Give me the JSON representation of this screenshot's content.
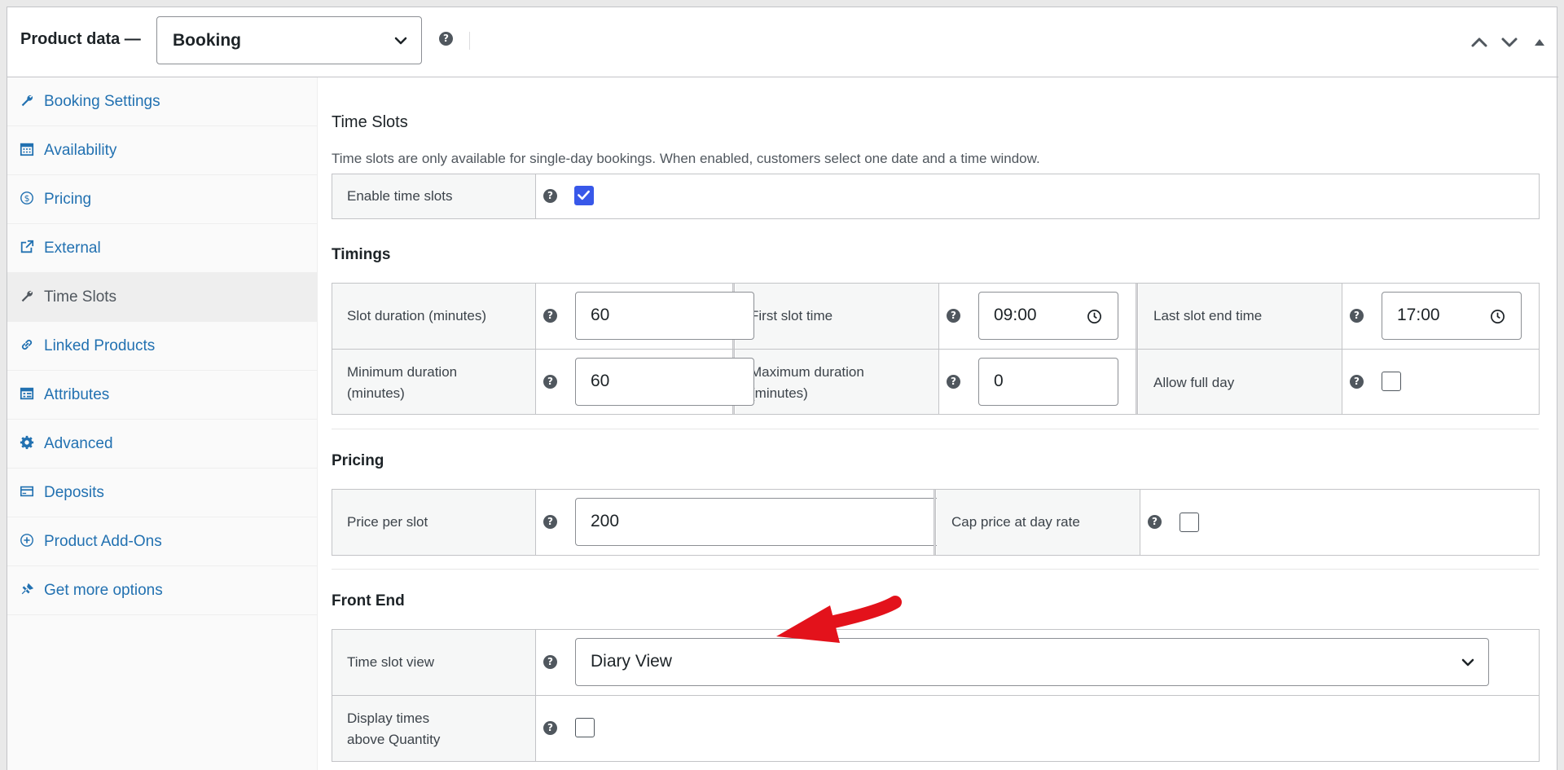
{
  "header": {
    "title": "Product data —",
    "type_select": "Booking"
  },
  "sidebar": {
    "items": [
      {
        "label": "Booking Settings",
        "icon": "wrench-icon"
      },
      {
        "label": "Availability",
        "icon": "calendar-icon"
      },
      {
        "label": "Pricing",
        "icon": "dollar-icon"
      },
      {
        "label": "External",
        "icon": "external-link-icon"
      },
      {
        "label": "Time Slots",
        "icon": "wrench-icon",
        "active": true
      },
      {
        "label": "Linked Products",
        "icon": "link-icon"
      },
      {
        "label": "Attributes",
        "icon": "list-icon"
      },
      {
        "label": "Advanced",
        "icon": "gear-icon"
      },
      {
        "label": "Deposits",
        "icon": "card-icon"
      },
      {
        "label": "Product Add-Ons",
        "icon": "plus-circle-icon"
      },
      {
        "label": "Get more options",
        "icon": "plugin-icon"
      }
    ]
  },
  "time_slots": {
    "title": "Time Slots",
    "description": "Time slots are only available for single-day bookings. When enabled, customers select one date and a time window.",
    "enable_label": "Enable time slots",
    "enable_checked": true
  },
  "timings": {
    "title": "Timings",
    "slot_duration_label": "Slot duration (minutes)",
    "slot_duration_value": "60",
    "first_slot_label": "First slot time",
    "first_slot_value": "09:00",
    "last_slot_label": "Last slot end time",
    "last_slot_value": "17:00",
    "min_duration_label_1": "Minimum duration",
    "min_duration_label_2": "(minutes)",
    "min_duration_value": "60",
    "max_duration_label_1": "Maximum duration",
    "max_duration_label_2": "(minutes)",
    "max_duration_value": "0",
    "allow_full_day_label": "Allow full day",
    "allow_full_day_checked": false
  },
  "pricing": {
    "title": "Pricing",
    "price_per_slot_label": "Price per slot",
    "price_per_slot_value": "200",
    "cap_label": "Cap price at day rate",
    "cap_checked": false
  },
  "front_end": {
    "title": "Front End",
    "view_label": "Time slot view",
    "view_value": "Diary View",
    "display_label_1": "Display times",
    "display_label_2": "above Quantity",
    "display_checked": false
  },
  "colors": {
    "link": "#2271b1",
    "checkbox_checked": "#3858e9",
    "annotation_arrow": "#e3121b"
  }
}
